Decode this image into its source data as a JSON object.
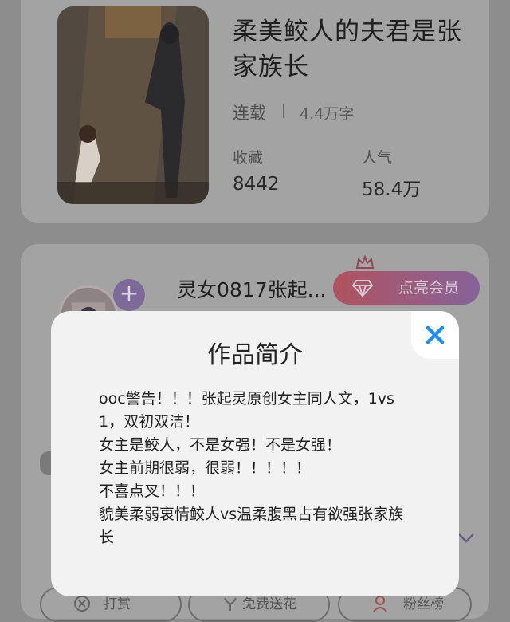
{
  "book": {
    "title": "柔美鲛人的夫君是张家族长",
    "status": "连载",
    "word_count": "4.4万字",
    "collect_label": "收藏",
    "collect_value": "8442",
    "popularity_label": "人气",
    "popularity_value": "58.4万"
  },
  "author": {
    "name": "灵女0817张起...",
    "follow_symbol": "+",
    "vip_button_label": "点亮会员"
  },
  "actions": {
    "tip_label": "打赏",
    "free_flower_label": "免费送花",
    "fans_rank_label": "粉丝榜"
  },
  "modal": {
    "title": "作品简介",
    "lines": [
      "ooc警告！！！张起灵原创女主同人文，1vs1，双初双洁！",
      "女主是鲛人，不是女强！不是女强！",
      "女主前期很弱，很弱！！！！！",
      "不喜点叉！！！",
      "貌美柔弱衷情鲛人vs温柔腹黑占有欲强张家族长"
    ]
  },
  "colors": {
    "accent_blue": "#1f8ef0",
    "vip_gradient_start": "#b0535f",
    "vip_gradient_end": "#86639a"
  }
}
